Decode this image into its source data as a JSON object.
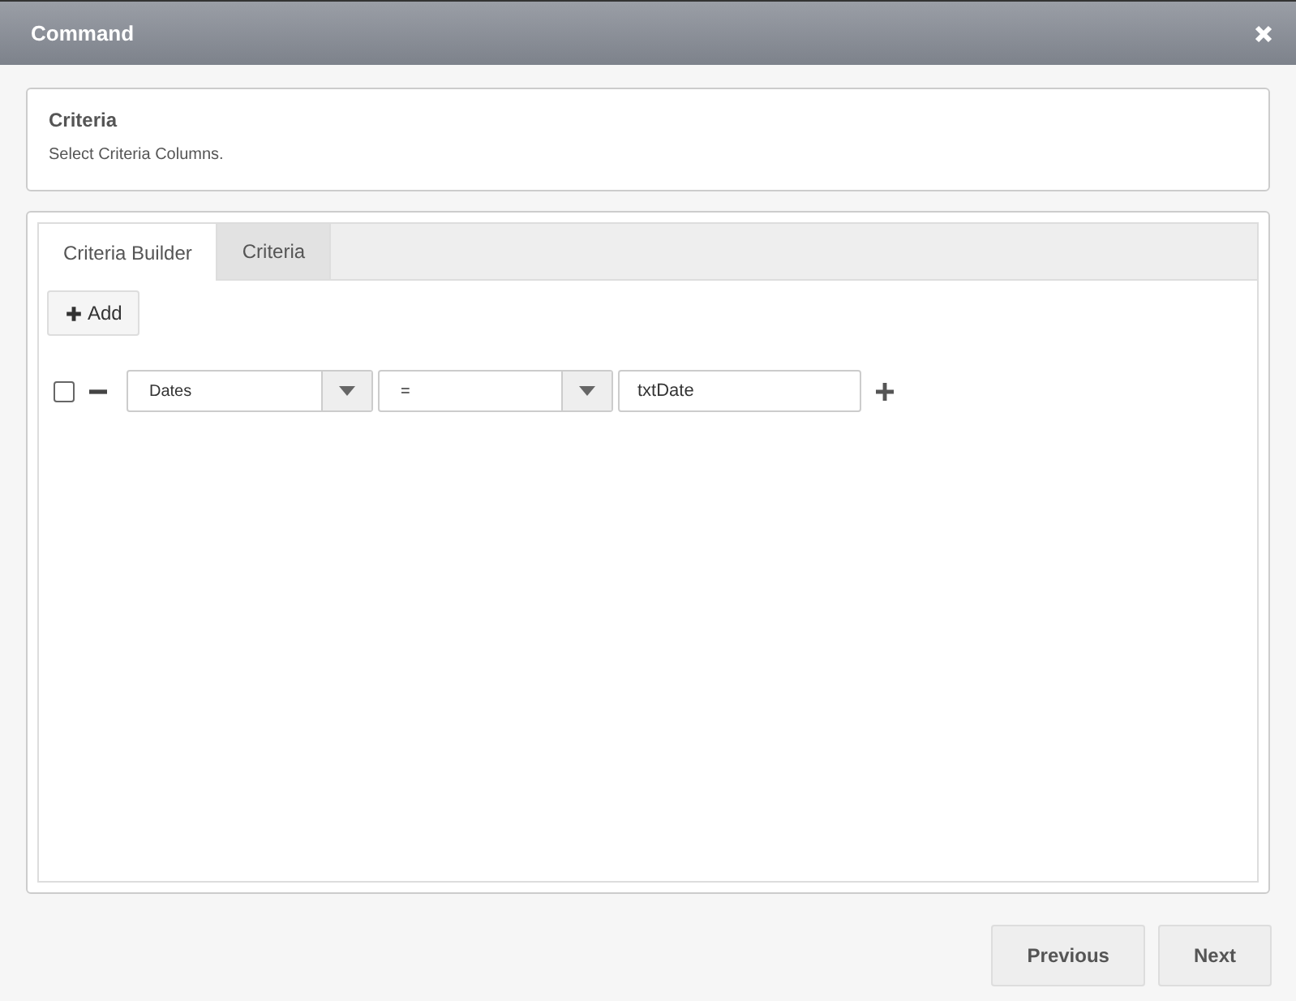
{
  "window": {
    "title": "Command"
  },
  "section": {
    "heading": "Criteria",
    "description": "Select Criteria Columns."
  },
  "tabs": [
    {
      "label": "Criteria Builder",
      "selected": true
    },
    {
      "label": "Criteria",
      "selected": false
    }
  ],
  "add_button": {
    "label": "Add"
  },
  "criteria_rows": [
    {
      "checked": false,
      "column": "Dates",
      "operator": "=",
      "value": "txtDate"
    }
  ],
  "buttons": [
    "Previous",
    "Next"
  ]
}
